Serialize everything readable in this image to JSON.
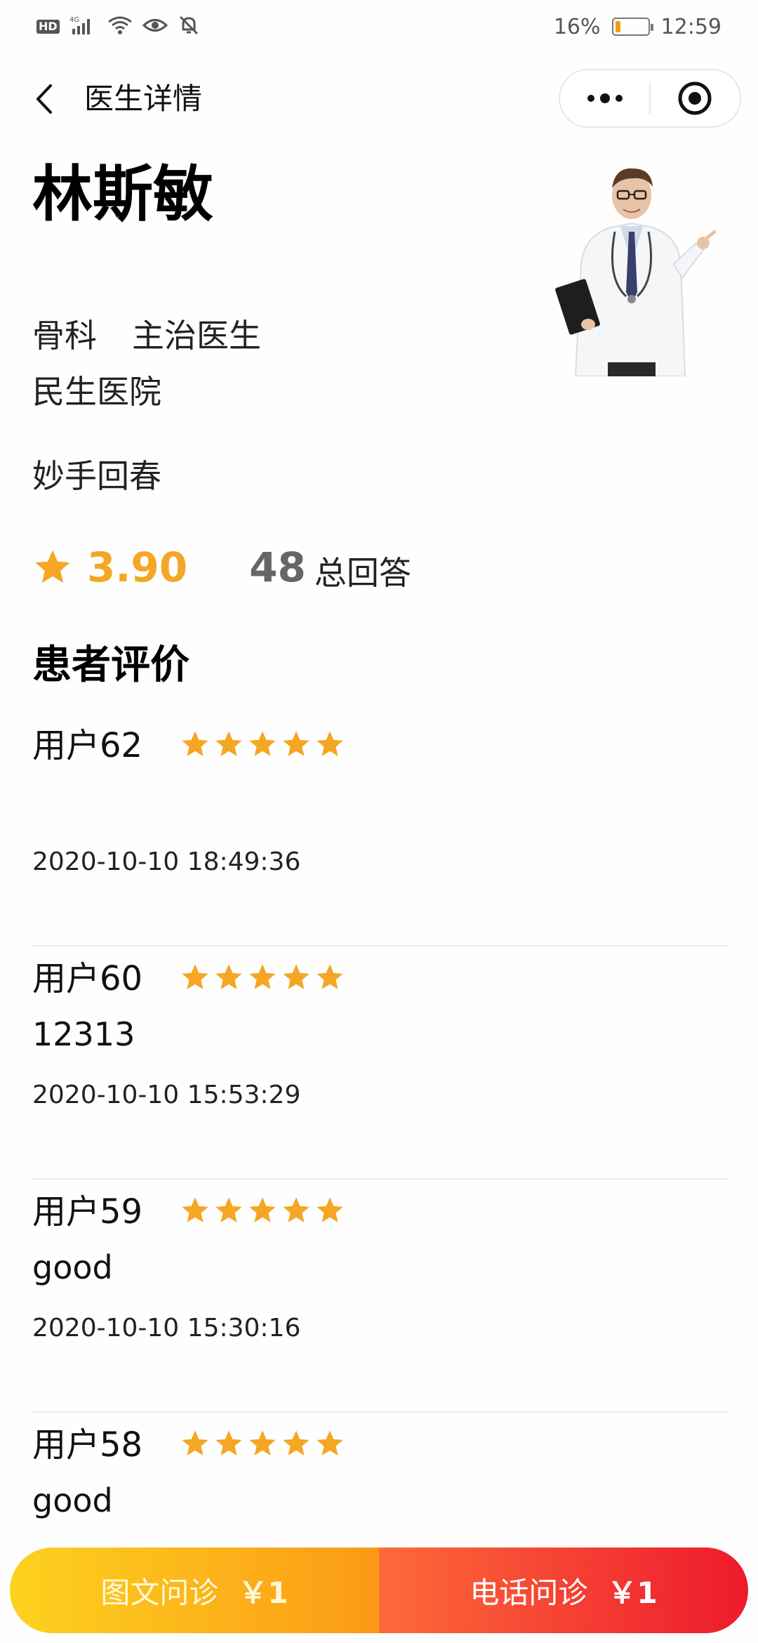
{
  "status_bar": {
    "network_badge": "HD",
    "signal_label": "4G",
    "battery_percent": "16%",
    "battery_level": 0.16,
    "time": "12:59"
  },
  "nav": {
    "title": "医生详情"
  },
  "doctor": {
    "name": "林斯敏",
    "department": "骨科",
    "title": "主治医生",
    "hospital": "民生医院",
    "motto": "妙手回春",
    "rating": "3.90",
    "answers_count": "48",
    "answers_label": "总回答"
  },
  "reviews_section": {
    "title": "患者评价",
    "items": [
      {
        "user": "用户62",
        "stars": 5,
        "comment": "",
        "time": "2020-10-10 18:49:36"
      },
      {
        "user": "用户60",
        "stars": 5,
        "comment": "12313",
        "time": "2020-10-10 15:53:29"
      },
      {
        "user": "用户59",
        "stars": 5,
        "comment": "good",
        "time": "2020-10-10 15:30:16"
      },
      {
        "user": "用户58",
        "stars": 5,
        "comment": "good",
        "time": ""
      }
    ]
  },
  "actions": {
    "text_consult_label": "图文问诊",
    "text_consult_price": "￥1",
    "phone_consult_label": "电话问诊",
    "phone_consult_price": "￥1"
  },
  "colors": {
    "star": "#f5a623",
    "rating": "#f5a623",
    "left_button_from": "#fdd21f",
    "left_button_to": "#fb9a16",
    "right_button_from": "#fd6a3a",
    "right_button_to": "#ee1a2c"
  },
  "icons": {
    "back": "chevron-left-icon",
    "more": "more-dots-icon",
    "close": "target-circle-icon",
    "star": "star-icon"
  }
}
